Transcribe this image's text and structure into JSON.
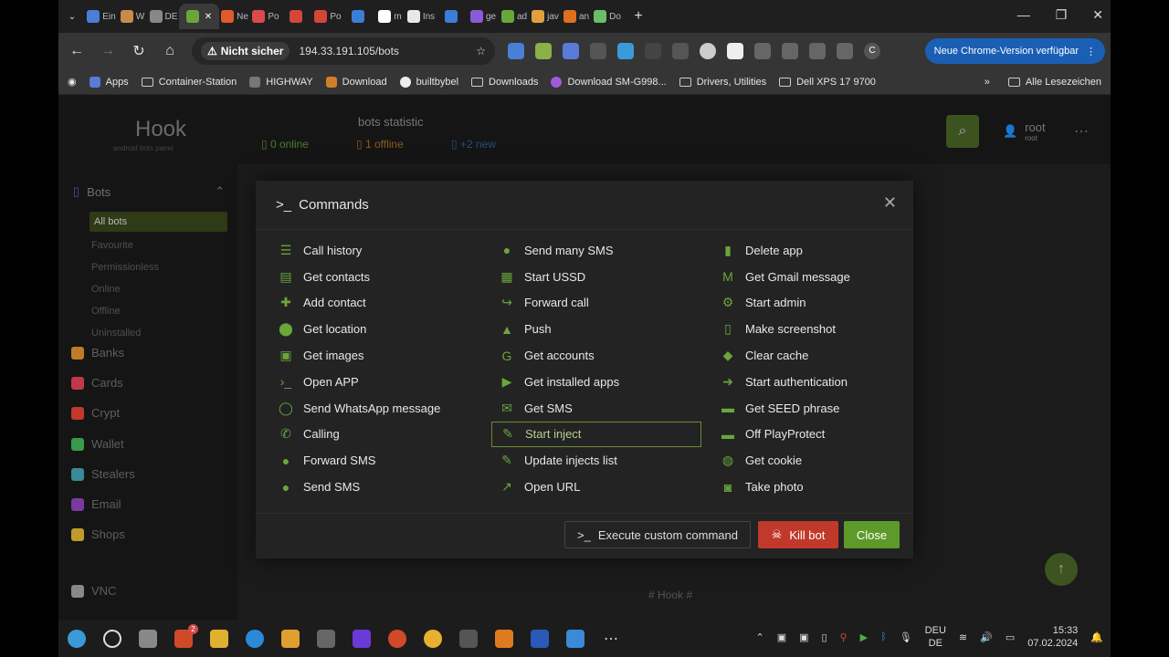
{
  "browser": {
    "tabs": [
      {
        "label": "Ein",
        "color": "#4a7fd8"
      },
      {
        "label": "W",
        "color": "#c98a4a"
      },
      {
        "label": "DE",
        "color": "#888888"
      },
      {
        "label": "",
        "color": "#6aa63a",
        "active": true
      },
      {
        "label": "Ne",
        "color": "#e05a2a"
      },
      {
        "label": "Po",
        "color": "#d94a4a"
      },
      {
        "label": "",
        "color": "#d44638"
      },
      {
        "label": "Po",
        "color": "#d44638"
      },
      {
        "label": "",
        "color": "#3b7ed8"
      },
      {
        "label": "m",
        "color": "#ffffff"
      },
      {
        "label": "Ins",
        "color": "#e8e8e8"
      },
      {
        "label": "",
        "color": "#3b7ed8"
      },
      {
        "label": "ge",
        "color": "#8a5ad8"
      },
      {
        "label": "ad",
        "color": "#6aa63a"
      },
      {
        "label": "jav",
        "color": "#e0a040"
      },
      {
        "label": "an",
        "color": "#e07020"
      },
      {
        "label": "Do",
        "color": "#6abe6a"
      }
    ],
    "security_label": "Nicht sicher",
    "url": "194.33.191.105/bots",
    "update_label": "Neue Chrome-Version verfügbar",
    "profile_initial": "C",
    "bookmarks": [
      "Apps",
      "Container-Station",
      "HIGHWAY",
      "Download",
      "builtbybel",
      "Downloads",
      "Download SM-G998...",
      "Drivers, Utilities",
      "Dell XPS 17 9700"
    ],
    "all_bookmarks": "Alle Lesezeichen"
  },
  "app": {
    "logo": "Hook",
    "logo_sub": "android bots panel",
    "stats_title": "bots statistic",
    "stats": {
      "online": "0 online",
      "offline": "1 offline",
      "new": "+2 new"
    },
    "user": {
      "name": "root",
      "role": "root"
    },
    "footer": "# Hook #",
    "sidebar": {
      "bots_label": "Bots",
      "sub": [
        "All bots",
        "Favourite",
        "Permissionless",
        "Online",
        "Offline",
        "Uninstalled"
      ],
      "items": [
        {
          "label": "Banks",
          "color": "#c07a2a"
        },
        {
          "label": "Cards",
          "color": "#c0394b"
        },
        {
          "label": "Crypt",
          "color": "#c0392b"
        },
        {
          "label": "Wallet",
          "color": "#3a9a4a"
        },
        {
          "label": "Stealers",
          "color": "#3a8a9a"
        },
        {
          "label": "Email",
          "color": "#7a3aa0"
        },
        {
          "label": "Shops",
          "color": "#c09a2a"
        },
        {
          "label": "VNC",
          "color": "#888888"
        }
      ]
    }
  },
  "modal": {
    "title": "Commands",
    "columns": [
      [
        {
          "label": "Call history",
          "icon": "list-icon"
        },
        {
          "label": "Get contacts",
          "icon": "contact-card-icon"
        },
        {
          "label": "Add contact",
          "icon": "add-person-icon"
        },
        {
          "label": "Get location",
          "icon": "location-pin-icon"
        },
        {
          "label": "Get images",
          "icon": "image-icon"
        },
        {
          "label": "Open APP",
          "icon": "terminal-icon"
        },
        {
          "label": "Send WhatsApp message",
          "icon": "whatsapp-icon"
        },
        {
          "label": "Calling",
          "icon": "phone-icon"
        },
        {
          "label": "Forward SMS",
          "icon": "sms-icon"
        },
        {
          "label": "Send SMS",
          "icon": "sms-icon"
        }
      ],
      [
        {
          "label": "Send many SMS",
          "icon": "sms-icon"
        },
        {
          "label": "Start USSD",
          "icon": "ussd-icon"
        },
        {
          "label": "Forward call",
          "icon": "forward-call-icon"
        },
        {
          "label": "Push",
          "icon": "bell-icon"
        },
        {
          "label": "Get accounts",
          "icon": "google-icon"
        },
        {
          "label": "Get installed apps",
          "icon": "play-store-icon"
        },
        {
          "label": "Get SMS",
          "icon": "envelope-icon"
        },
        {
          "label": "Start inject",
          "icon": "syringe-icon",
          "highlighted": true
        },
        {
          "label": "Update injects list",
          "icon": "syringe-icon"
        },
        {
          "label": "Open URL",
          "icon": "external-link-icon"
        }
      ],
      [
        {
          "label": "Delete app",
          "icon": "trash-icon"
        },
        {
          "label": "Get Gmail message",
          "icon": "gmail-icon"
        },
        {
          "label": "Start admin",
          "icon": "admin-icon"
        },
        {
          "label": "Make screenshot",
          "icon": "smartphone-icon"
        },
        {
          "label": "Clear cache",
          "icon": "eraser-icon"
        },
        {
          "label": "Start authentication",
          "icon": "login-icon"
        },
        {
          "label": "Get SEED phrase",
          "icon": "seed-icon"
        },
        {
          "label": "Off PlayProtect",
          "icon": "seed-icon"
        },
        {
          "label": "Get cookie",
          "icon": "cookie-icon"
        },
        {
          "label": "Take photo",
          "icon": "camera-icon"
        }
      ]
    ],
    "buttons": {
      "custom": "Execute custom command",
      "kill": "Kill bot",
      "close": "Close"
    }
  },
  "taskbar": {
    "lang": [
      "DEU",
      "DE"
    ],
    "time": "15:33",
    "date": "07.02.2024",
    "badge": "2"
  }
}
